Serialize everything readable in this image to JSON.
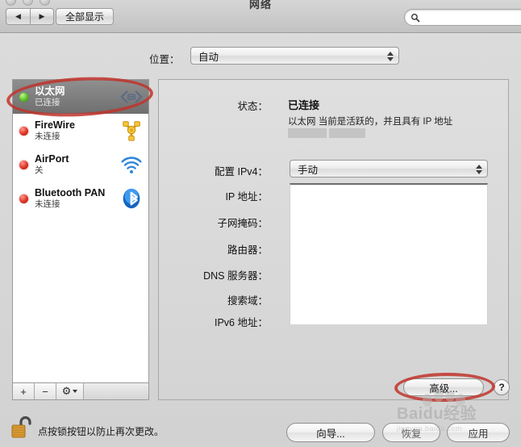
{
  "window": {
    "title": "网络",
    "traffic_lights": [
      "close",
      "minimize",
      "zoom"
    ]
  },
  "toolbar": {
    "back_label": "◀",
    "forward_label": "▶",
    "show_all_label": "全部显示",
    "search_placeholder": "",
    "search_value": "",
    "search_icon": "search-icon"
  },
  "location": {
    "label": "位置：",
    "value": "自动",
    "options": [
      "自动"
    ]
  },
  "sidebar": {
    "services": [
      {
        "name": "以太网",
        "state": "已连接",
        "led": "green",
        "icon": "ethernet-icon",
        "selected": true
      },
      {
        "name": "FireWire",
        "state": "未连接",
        "led": "red",
        "icon": "firewire-icon",
        "selected": false
      },
      {
        "name": "AirPort",
        "state": "关",
        "led": "red",
        "icon": "airport-wifi-icon",
        "selected": false
      },
      {
        "name": "Bluetooth PAN",
        "state": "未连接",
        "led": "red",
        "icon": "bluetooth-icon",
        "selected": false
      }
    ],
    "footer": {
      "add_label": "+",
      "remove_label": "−",
      "gear_label": "⚙"
    }
  },
  "detail": {
    "status_label": "状态：",
    "status_value": "已连接",
    "status_note": "以太网 当前是活跃的，并且具有 IP 地址",
    "ip_redacted": true,
    "configure_label": "配置 IPv4：",
    "configure_value": "手动",
    "configure_options": [
      "手动"
    ],
    "fields": [
      {
        "label": "IP 地址：",
        "value": ""
      },
      {
        "label": "子网掩码：",
        "value": ""
      },
      {
        "label": "路由器：",
        "value": ""
      },
      {
        "label": "DNS 服务器：",
        "value": ""
      },
      {
        "label": "搜索域：",
        "value": ""
      },
      {
        "label": "IPv6 地址：",
        "value": ""
      }
    ],
    "advanced_label": "高级...",
    "help_label": "?"
  },
  "bottom": {
    "lock_icon": "unlocked-padlock-icon",
    "lock_text": "点按锁按钮以防止再次更改。",
    "assist_label": "向导...",
    "revert_label": "恢复",
    "apply_label": "应用"
  },
  "annotations": {
    "color": "#c0342c",
    "targets": [
      "ethernet-service-row",
      "advanced-button"
    ]
  },
  "watermark": {
    "main": "Baidu经验",
    "sub": "jingyan.baidu.com"
  }
}
